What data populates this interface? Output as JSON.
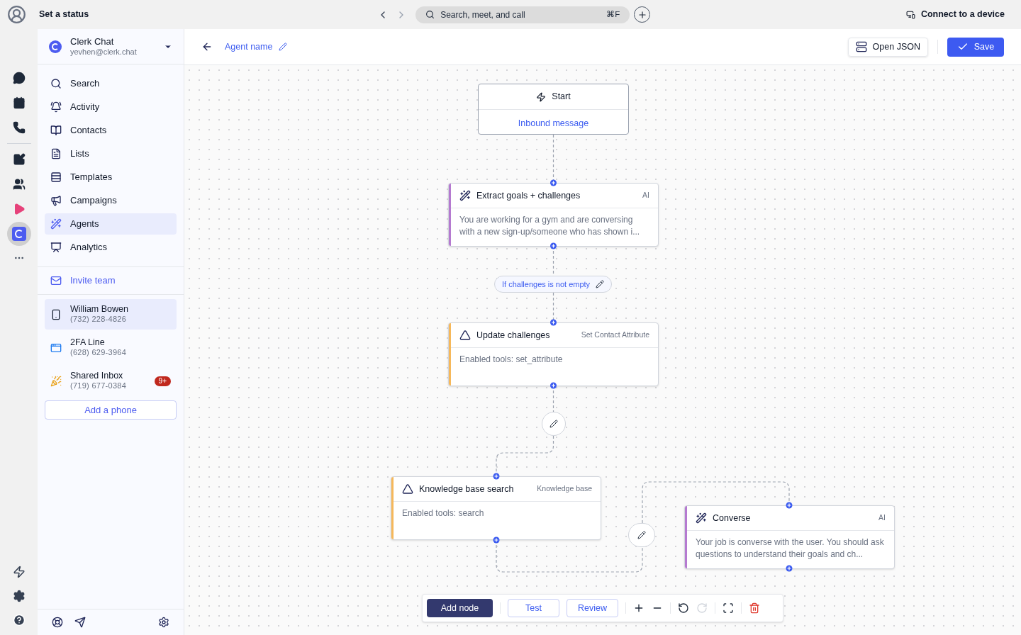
{
  "topbar": {
    "status": "Set a status",
    "search_placeholder": "Search, meet, and call",
    "shortcut": "⌘F",
    "device": "Connect to a device"
  },
  "rail": [
    {
      "kind": "chat",
      "selected": false
    },
    {
      "kind": "calendar",
      "selected": false
    },
    {
      "kind": "phone",
      "selected": false
    },
    {
      "kind": "compose",
      "selected": false
    },
    {
      "kind": "team",
      "selected": false
    },
    {
      "kind": "play",
      "selected": false
    },
    {
      "kind": "clerk",
      "selected": true
    }
  ],
  "account": {
    "name": "Clerk Chat",
    "email": "yevhen@clerk.chat"
  },
  "nav": [
    {
      "kind": "search",
      "label": "Search",
      "selected": false
    },
    {
      "kind": "activity",
      "label": "Activity",
      "selected": false
    },
    {
      "kind": "contacts",
      "label": "Contacts",
      "selected": false
    },
    {
      "kind": "lists",
      "label": "Lists",
      "selected": false
    },
    {
      "kind": "templates",
      "label": "Templates",
      "selected": false
    },
    {
      "kind": "campaigns",
      "label": "Campaigns",
      "selected": false
    },
    {
      "kind": "agents",
      "label": "Agents",
      "selected": true
    },
    {
      "kind": "analytics",
      "label": "Analytics",
      "selected": false
    }
  ],
  "invite": "Invite team",
  "phones": [
    {
      "kind": "mobile",
      "name": "William Bowen",
      "number": "(732) 228-4826",
      "selected": true
    },
    {
      "kind": "app",
      "name": "2FA Line",
      "number": "(628) 629-3964",
      "selected": false
    },
    {
      "kind": "party",
      "name": "Shared Inbox",
      "number": "(719) 677-0384",
      "selected": false,
      "badge": "9+"
    }
  ],
  "add_phone": "Add a phone",
  "header": {
    "agent_name": "Agent name",
    "open_json": "Open JSON",
    "save": "Save"
  },
  "start": {
    "title": "Start",
    "trigger": "Inbound message"
  },
  "nodes": [
    {
      "kind": "ai",
      "title": "Extract goals + challenges",
      "type": "AI",
      "body": "You are working for a gym and are conversing with a new sign-up/someone who has shown i...",
      "color": "#b57ad0"
    },
    {
      "kind": "tool",
      "title": "Update challenges",
      "type": "Set Contact Attribute",
      "body": "Enabled tools: set_attribute",
      "color": "#f6b85a"
    },
    {
      "kind": "tool",
      "title": "Knowledge base search",
      "type": "Knowledge base",
      "body": "Enabled tools: search",
      "color": "#f6b85a"
    },
    {
      "kind": "ai",
      "title": "Converse",
      "type": "AI",
      "body": "Your job is converse with the user. You should ask questions to understand their goals and ch...",
      "color": "#b57ad0"
    }
  ],
  "condition": "If challenges is not empty",
  "toolbar": {
    "add_node": "Add node",
    "test": "Test",
    "review": "Review"
  }
}
